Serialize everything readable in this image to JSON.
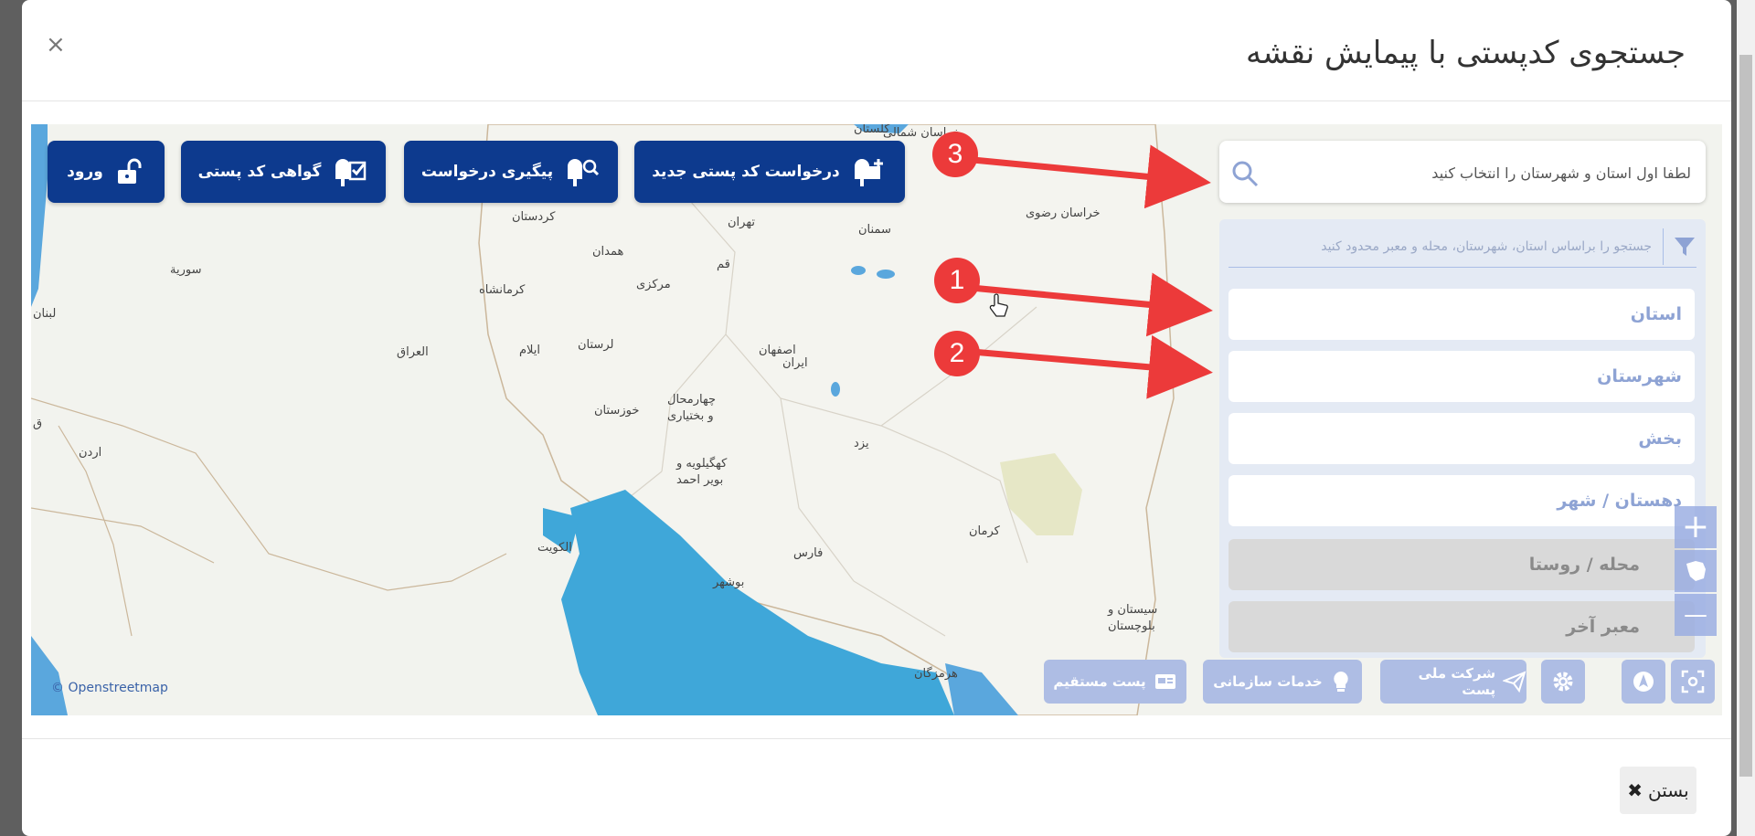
{
  "modal": {
    "title": "جستجوی کدپستی با پیمایش نقشه",
    "close_symbol": "×"
  },
  "toolbar": {
    "new_request_label": "درخواست کد پستی جدید",
    "track_request_label": "پیگیری درخواست",
    "certificate_label": "گواهی کد پستی",
    "login_label": "ورود",
    "button_color": "#0d3a8e"
  },
  "search": {
    "placeholder": "لطفا اول استان و شهرستان را انتخاب کنید"
  },
  "filters": {
    "hint": "جستجو را براساس استان، شهرستان، محله و معبر محدود کنید",
    "fields": [
      {
        "label": "استان"
      },
      {
        "label": "شهرستان"
      },
      {
        "label": "بخش"
      },
      {
        "label": "دهستان / شهر"
      },
      {
        "label": "محله / روستا"
      },
      {
        "label": "معبر آخر"
      }
    ]
  },
  "map_controls": {
    "zoom_in": "+",
    "zoom_out": "—"
  },
  "bottom_bar": {
    "national_post_label": "شرکت ملی پست",
    "org_services_label": "خدمات سازمانی",
    "direct_post_label": "پست مستقیم"
  },
  "map": {
    "attribution": "© Openstreetmap",
    "labels": {
      "khorasan_north": "خراسان شمالی",
      "golestan": "گلستان",
      "khorasan_razavi": "خراسان رضوی",
      "kordestan": "کردستان",
      "tehran": "تهران",
      "semnan": "سمنان",
      "hamedan": "همدان",
      "qom": "قم",
      "syria": "سوریة",
      "markazi": "مرکزی",
      "kermanshah": "کرمانشاه",
      "lebanon": "لبنان",
      "iraq": "العراق",
      "ilam": "ایلام",
      "lorestan": "لرستان",
      "isfahan": "اصفهان",
      "iran": "ایران",
      "chaharmahal1": "چهارمحال",
      "chaharmahal2": "و بختیاری",
      "khuzestan": "خوزستان",
      "jordan": "اردن",
      "yazd": "یزد",
      "kohgiluyeh1": "کهگیلویه و",
      "kohgiluyeh2": "بویر احمد",
      "kerman": "کرمان",
      "kuwait": "الكويت",
      "fars": "فارس",
      "bushehr": "بوشهر",
      "sistan1": "سیستان و",
      "sistan2": "بلوچستان",
      "hormozgan": "هرمزگان",
      "q": "ق"
    }
  },
  "footer": {
    "close_label": "بستن",
    "close_icon": "✖"
  },
  "annotations": [
    "1",
    "2",
    "3"
  ]
}
